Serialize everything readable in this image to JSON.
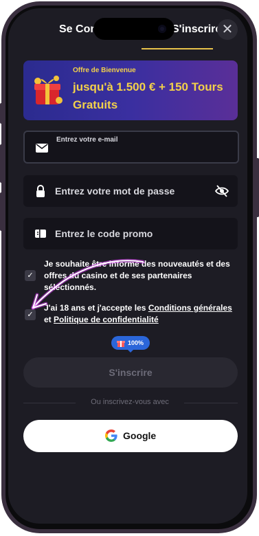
{
  "tabs": {
    "login": "Se Connecter",
    "signup": "S'inscrire"
  },
  "close_icon": "close-icon",
  "banner": {
    "subtitle": "Offre de Bienvenue",
    "headline": "jusqu'à 1.500 € + 150 Tours Gratuits"
  },
  "fields": {
    "email_label": "Entrez votre e-mail",
    "password_placeholder": "Entrez votre mot de passe",
    "promo_placeholder": "Entrez le code promo"
  },
  "checkboxes": {
    "newsletter": "Je souhaite être informé des nouveautés et des offres du casino et de ses partenaires sélectionnés.",
    "age_prefix": "J'ai 18 ans et j'accepte les ",
    "terms_link": "Conditions générales",
    "age_middle": " et ",
    "privacy_link": "Politique de confidentialité"
  },
  "promo_pill": "100%",
  "submit_label": "S'inscrire",
  "divider_text": "Ou inscrivez-vous avec",
  "google_label": "Google",
  "colors": {
    "background": "#1d1c24",
    "accent_yellow": "#f3d14a",
    "banner_blue": "#2b2b8f",
    "pill_blue": "#2b66d9",
    "annotation": "#e040ff"
  }
}
